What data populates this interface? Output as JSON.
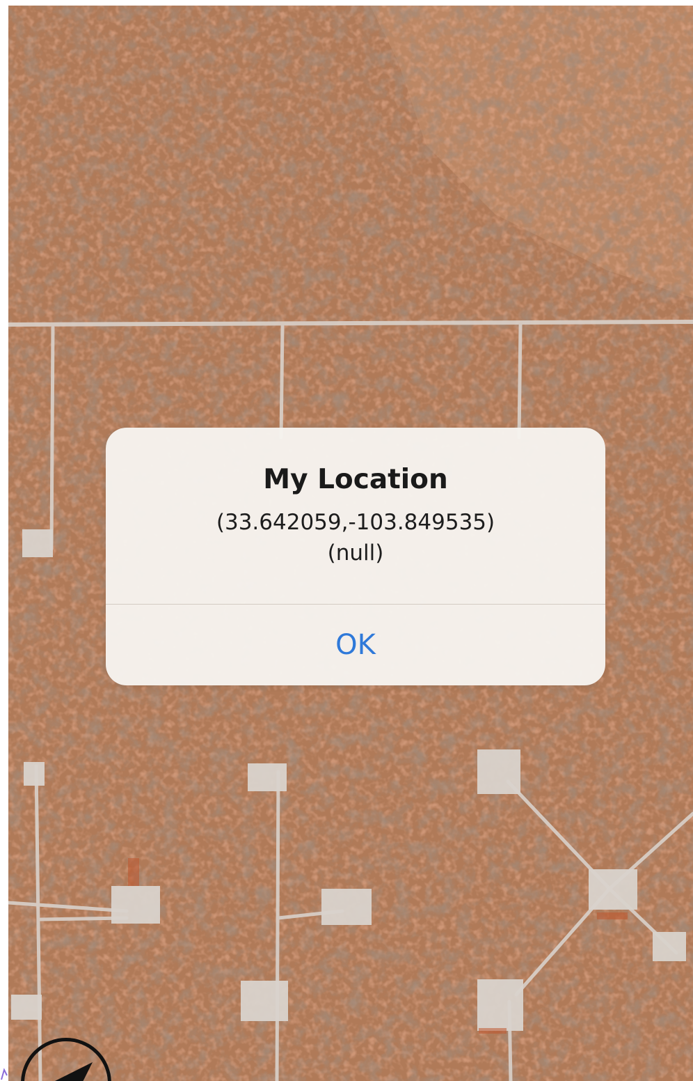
{
  "map": {
    "type": "satellite"
  },
  "alert": {
    "title": "My Location",
    "coordinates": "(33.642059,-103.849535)",
    "subtitle": "(null)",
    "ok_label": "OK"
  },
  "controls": {
    "tracking_icon": "location-arrow-icon"
  },
  "colors": {
    "map_ground": "#b07a58",
    "road": "#d8cfc8",
    "alert_background": "#f6f3ee",
    "ok_button_text": "#2f79d9"
  }
}
